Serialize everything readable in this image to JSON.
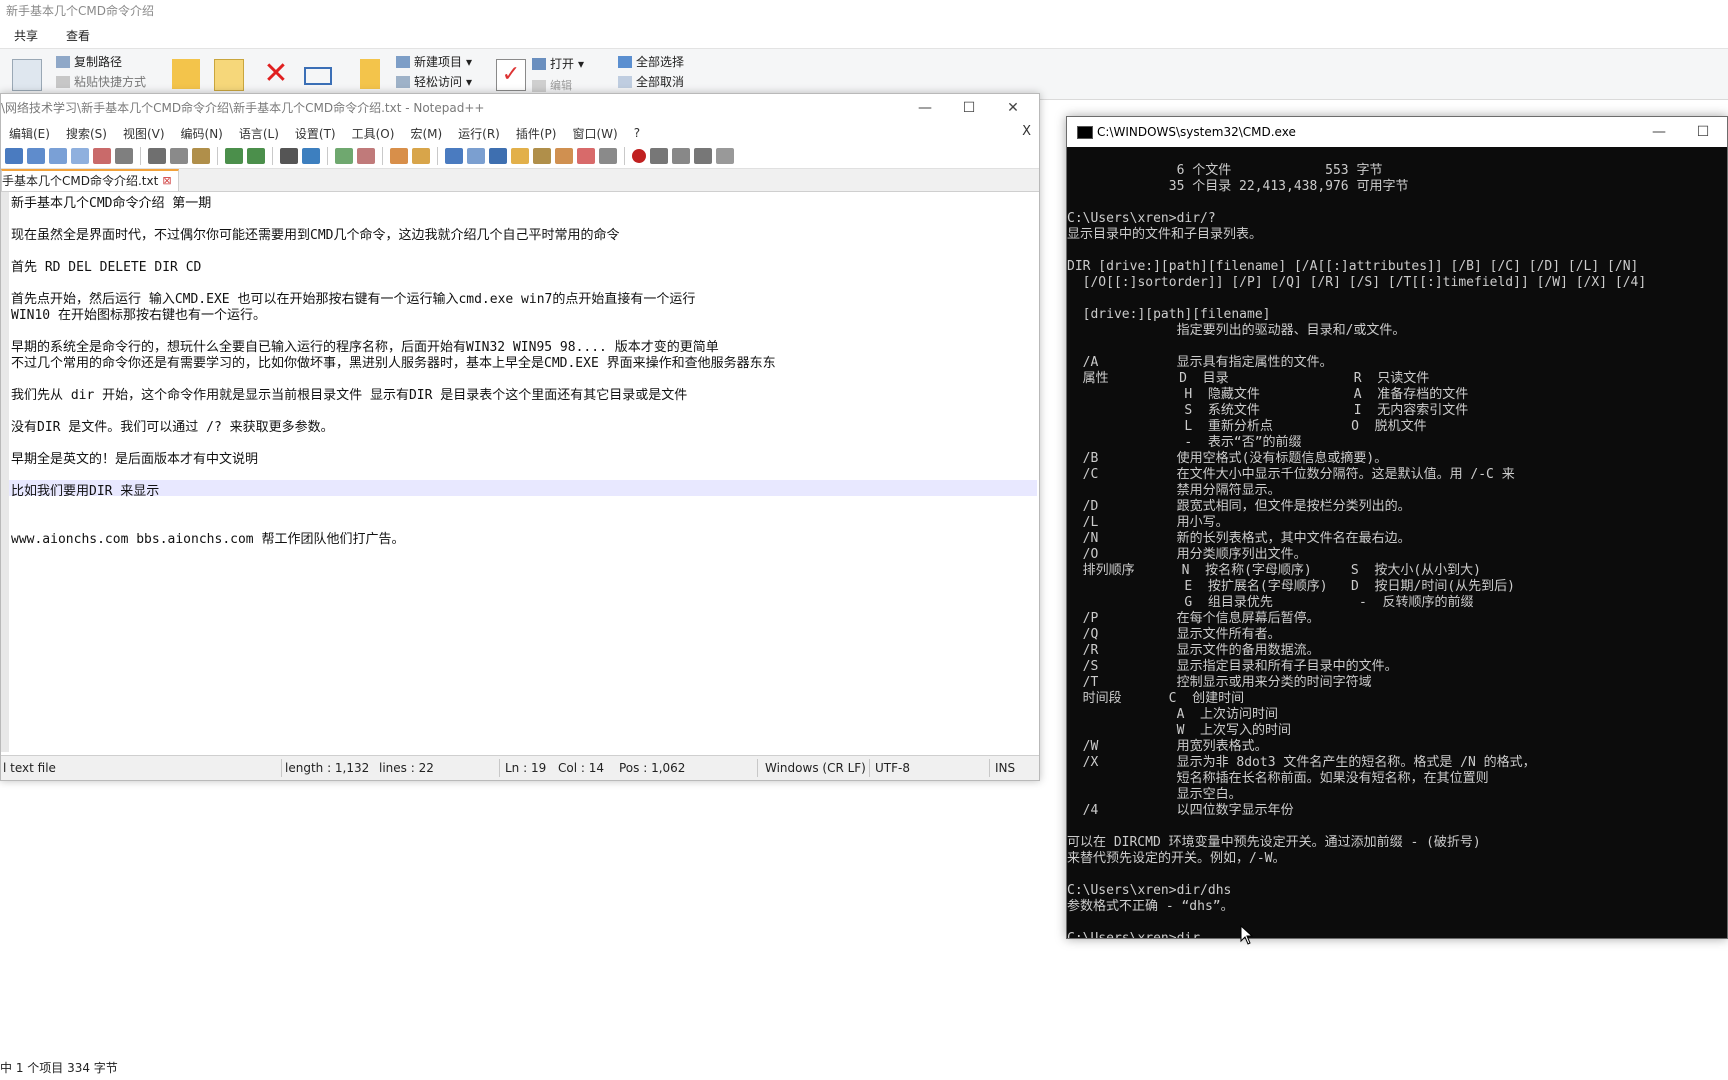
{
  "explorer": {
    "title": "新手基本几个CMD命令介绍",
    "tabs": [
      "共享",
      "查看"
    ],
    "ribbon": {
      "copy_path": "复制路径",
      "paste_shortcut": "粘贴快捷方式",
      "new_item": "新建项目",
      "easy_access": "轻松访问",
      "open": "打开",
      "edit": "编辑",
      "select_all": "全部选择",
      "select_none": "全部取消"
    },
    "status": "中 1 个项目  334 字节"
  },
  "notepad": {
    "title": "\\网络技术学习\\新手基本几个CMD命令介绍\\新手基本几个CMD命令介绍.txt - Notepad++",
    "menu": [
      "编辑(E)",
      "搜索(S)",
      "视图(V)",
      "编码(N)",
      "语言(L)",
      "设置(T)",
      "工具(O)",
      "宏(M)",
      "运行(R)",
      "插件(P)",
      "窗口(W)",
      "?"
    ],
    "close_x": "X",
    "tab_label": "手基本几个CMD命令介绍.txt",
    "tab_close": "⊠",
    "lines": [
      "新手基本几个CMD命令介绍 第一期",
      "",
      "现在虽然全是界面时代，不过偶尔你可能还需要用到CMD几个命令，这边我就介绍几个自己平时常用的命令",
      "",
      "首先 RD DEL DELETE DIR CD",
      "",
      "首先点开始，然后运行 输入CMD.EXE 也可以在开始那按右键有一个运行输入cmd.exe win7的点开始直接有一个运行",
      "WIN10 在开始图标那按右键也有一个运行。",
      "",
      "早期的系统全是命令行的，想玩什么全要自已输入运行的程序名称，后面开始有WIN32 WIN95 98.... 版本才变的更简单",
      "不过几个常用的命令你还是有需要学习的，比如你做坏事，黑进别人服务器时，基本上早全是CMD.EXE 界面来操作和查他服务器东东",
      "",
      "我们先从 dir 开始，这个命令作用就是显示当前根目录文件 显示有DIR 是目录表个这个里面还有其它目录或是文件",
      "",
      "没有DIR 是文件。我们可以通过 /? 来获取更多参数。",
      "",
      "早期全是英文的！是后面版本才有中文说明",
      "",
      "比如我们要用DIR 来显示",
      "",
      "",
      "www.aionchs.com bbs.aionchs.com 帮工作团队他们打广告。"
    ],
    "status": {
      "type": "l text file",
      "length": "length : 1,132",
      "lines": "lines : 22",
      "ln": "Ln : 19",
      "col": "Col : 14",
      "pos": "Pos : 1,062",
      "eol": "Windows (CR LF)",
      "encoding": "UTF-8",
      "mode": "INS"
    }
  },
  "cmd": {
    "title": "C:\\WINDOWS\\system32\\CMD.exe",
    "lines": [
      "              6 个文件            553 字节",
      "             35 个目录 22,413,438,976 可用字节",
      "",
      "C:\\Users\\xren>dir/?",
      "显示目录中的文件和子目录列表。",
      "",
      "DIR [drive:][path][filename] [/A[[:]attributes]] [/B] [/C] [/D] [/L] [/N]",
      "  [/O[[:]sortorder]] [/P] [/Q] [/R] [/S] [/T[[:]timefield]] [/W] [/X] [/4]",
      "",
      "  [drive:][path][filename]",
      "              指定要列出的驱动器、目录和/或文件。",
      "",
      "  /A          显示具有指定属性的文件。",
      "  属性         D  目录                R  只读文件",
      "               H  隐藏文件            A  准备存档的文件",
      "               S  系统文件            I  无内容索引文件",
      "               L  重新分析点          O  脱机文件",
      "               -  表示“否”的前缀",
      "  /B          使用空格式(没有标题信息或摘要)。",
      "  /C          在文件大小中显示千位数分隔符。这是默认值。用 /-C 来",
      "              禁用分隔符显示。",
      "  /D          跟宽式相同，但文件是按栏分类列出的。",
      "  /L          用小写。",
      "  /N          新的长列表格式，其中文件名在最右边。",
      "  /O          用分类顺序列出文件。",
      "  排列顺序      N  按名称(字母顺序)     S  按大小(从小到大)",
      "               E  按扩展名(字母顺序)   D  按日期/时间(从先到后)",
      "               G  组目录优先           -  反转顺序的前缀",
      "  /P          在每个信息屏幕后暂停。",
      "  /Q          显示文件所有者。",
      "  /R          显示文件的备用数据流。",
      "  /S          显示指定目录和所有子目录中的文件。",
      "  /T          控制显示或用来分类的时间字符域",
      "  时间段      C  创建时间",
      "              A  上次访问时间",
      "              W  上次写入的时间",
      "  /W          用宽列表格式。",
      "  /X          显示为非 8dot3 文件名产生的短名称。格式是 /N 的格式，",
      "              短名称插在长名称前面。如果没有短名称，在其位置则",
      "              显示空白。",
      "  /4          以四位数字显示年份",
      "",
      "可以在 DIRCMD 环境变量中预先设定开关。通过添加前缀 - (破折号)",
      "来替代预先设定的开关。例如，/-W。",
      "",
      "C:\\Users\\xren>dir/dhs",
      "参数格式不正确 - “dhs”。",
      "",
      "C:\\Users\\xren>dir"
    ]
  },
  "colors": {
    "cmd_bg": "#0c0c0c",
    "cmd_fg": "#cccccc",
    "current_line": "#e8e8ff",
    "tab_accent": "#f2a23a"
  }
}
